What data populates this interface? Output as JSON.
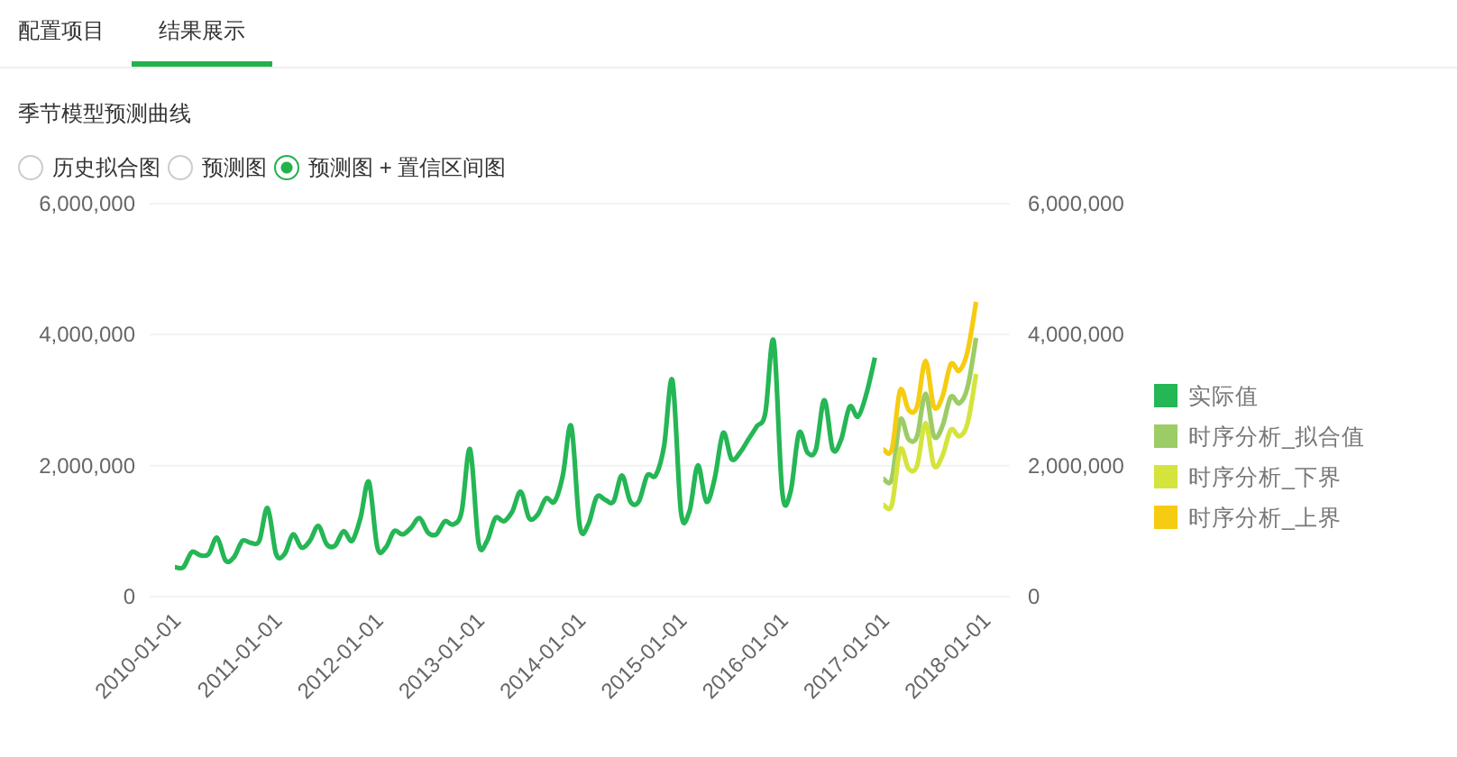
{
  "tabs": [
    {
      "label": "配置项目",
      "selected": false
    },
    {
      "label": "结果展示",
      "selected": true
    }
  ],
  "section_title": "季节模型预测曲线",
  "view_options": [
    {
      "label": "历史拟合图",
      "selected": false
    },
    {
      "label": "预测图",
      "selected": false
    },
    {
      "label": "预测图 + 置信区间图",
      "selected": true
    }
  ],
  "chart_data": {
    "type": "line",
    "categories": [
      "2010-01-01",
      null,
      null,
      null,
      null,
      null,
      null,
      null,
      null,
      null,
      null,
      null,
      "2011-01-01",
      null,
      null,
      null,
      null,
      null,
      null,
      null,
      null,
      null,
      null,
      null,
      "2012-01-01",
      null,
      null,
      null,
      null,
      null,
      null,
      null,
      null,
      null,
      null,
      null,
      "2013-01-01",
      null,
      null,
      null,
      null,
      null,
      null,
      null,
      null,
      null,
      null,
      null,
      "2014-01-01",
      null,
      null,
      null,
      null,
      null,
      null,
      null,
      null,
      null,
      null,
      null,
      "2015-01-01",
      null,
      null,
      null,
      null,
      null,
      null,
      null,
      null,
      null,
      null,
      null,
      "2016-01-01",
      null,
      null,
      null,
      null,
      null,
      null,
      null,
      null,
      null,
      null,
      null,
      "2017-01-01",
      null,
      null,
      null,
      null,
      null,
      null,
      null,
      null,
      null,
      null,
      null,
      "2018-01-01"
    ],
    "legend": "right",
    "ylim": [
      0,
      6000000
    ],
    "y2lim": [
      0,
      6000000
    ],
    "yticks": [
      {
        "value": 0,
        "label": "0"
      },
      {
        "value": 2000000,
        "label": "2,000,000"
      },
      {
        "value": 4000000,
        "label": "4,000,000"
      },
      {
        "value": 6000000,
        "label": "6,000,000"
      }
    ],
    "y2ticks": [
      {
        "value": 0,
        "label": "0"
      },
      {
        "value": 2000000,
        "label": "2,000,000"
      },
      {
        "value": 4000000,
        "label": "4,000,000"
      },
      {
        "value": 6000000,
        "label": "6,000,000"
      }
    ],
    "series": [
      {
        "name": "实际值",
        "color": "#25b655",
        "values": [
          450000,
          450000,
          680000,
          630000,
          650000,
          900000,
          550000,
          600000,
          850000,
          820000,
          850000,
          1350000,
          650000,
          650000,
          950000,
          750000,
          850000,
          1080000,
          800000,
          780000,
          1000000,
          850000,
          1200000,
          1750000,
          750000,
          750000,
          1000000,
          950000,
          1050000,
          1200000,
          980000,
          950000,
          1150000,
          1100000,
          1300000,
          2250000,
          820000,
          850000,
          1200000,
          1150000,
          1300000,
          1600000,
          1200000,
          1250000,
          1500000,
          1450000,
          1850000,
          2600000,
          1080000,
          1100000,
          1520000,
          1480000,
          1450000,
          1850000,
          1450000,
          1450000,
          1850000,
          1850000,
          2300000,
          3300000,
          1300000,
          1300000,
          2000000,
          1450000,
          1800000,
          2500000,
          2100000,
          2200000,
          2400000,
          2600000,
          2800000,
          3900000,
          1600000,
          1600000,
          2500000,
          2200000,
          2250000,
          3000000,
          2250000,
          2400000,
          2900000,
          2750000,
          3100000,
          3650000,
          null,
          null,
          null,
          null,
          null,
          null,
          null,
          null,
          null,
          null,
          null,
          null,
          null
        ]
      },
      {
        "name": "时序分析_拟合值",
        "color": "#9ccc65",
        "values": [
          null,
          null,
          null,
          null,
          null,
          null,
          null,
          null,
          null,
          null,
          null,
          null,
          null,
          null,
          null,
          null,
          null,
          null,
          null,
          null,
          null,
          null,
          null,
          null,
          null,
          null,
          null,
          null,
          null,
          null,
          null,
          null,
          null,
          null,
          null,
          null,
          null,
          null,
          null,
          null,
          null,
          null,
          null,
          null,
          null,
          null,
          null,
          null,
          null,
          null,
          null,
          null,
          null,
          null,
          null,
          null,
          null,
          null,
          null,
          null,
          null,
          null,
          null,
          null,
          null,
          null,
          null,
          null,
          null,
          null,
          null,
          null,
          null,
          null,
          null,
          null,
          null,
          null,
          null,
          null,
          null,
          null,
          null,
          null,
          1800000,
          1800000,
          2700000,
          2400000,
          2450000,
          3100000,
          2450000,
          2600000,
          3050000,
          2950000,
          3200000,
          3950000,
          null
        ]
      },
      {
        "name": "时序分析_下界",
        "color": "#d4e43c",
        "values": [
          null,
          null,
          null,
          null,
          null,
          null,
          null,
          null,
          null,
          null,
          null,
          null,
          null,
          null,
          null,
          null,
          null,
          null,
          null,
          null,
          null,
          null,
          null,
          null,
          null,
          null,
          null,
          null,
          null,
          null,
          null,
          null,
          null,
          null,
          null,
          null,
          null,
          null,
          null,
          null,
          null,
          null,
          null,
          null,
          null,
          null,
          null,
          null,
          null,
          null,
          null,
          null,
          null,
          null,
          null,
          null,
          null,
          null,
          null,
          null,
          null,
          null,
          null,
          null,
          null,
          null,
          null,
          null,
          null,
          null,
          null,
          null,
          null,
          null,
          null,
          null,
          null,
          null,
          null,
          null,
          null,
          null,
          null,
          null,
          1400000,
          1400000,
          2250000,
          1950000,
          2000000,
          2650000,
          2000000,
          2150000,
          2550000,
          2450000,
          2650000,
          3400000,
          null
        ]
      },
      {
        "name": "时序分析_上界",
        "color": "#f5cc11",
        "values": [
          null,
          null,
          null,
          null,
          null,
          null,
          null,
          null,
          null,
          null,
          null,
          null,
          null,
          null,
          null,
          null,
          null,
          null,
          null,
          null,
          null,
          null,
          null,
          null,
          null,
          null,
          null,
          null,
          null,
          null,
          null,
          null,
          null,
          null,
          null,
          null,
          null,
          null,
          null,
          null,
          null,
          null,
          null,
          null,
          null,
          null,
          null,
          null,
          null,
          null,
          null,
          null,
          null,
          null,
          null,
          null,
          null,
          null,
          null,
          null,
          null,
          null,
          null,
          null,
          null,
          null,
          null,
          null,
          null,
          null,
          null,
          null,
          null,
          null,
          null,
          null,
          null,
          null,
          null,
          null,
          null,
          null,
          null,
          null,
          2250000,
          2250000,
          3150000,
          2850000,
          2900000,
          3600000,
          2900000,
          3050000,
          3550000,
          3450000,
          3750000,
          4500000,
          null
        ]
      }
    ]
  }
}
